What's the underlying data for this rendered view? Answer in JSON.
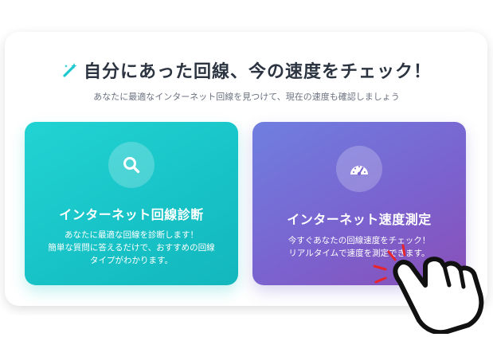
{
  "header": {
    "title": "自分にあった回線、今の速度をチェック！",
    "subtitle": "あなたに最適なインターネット回線を見つけて、現在の速度も確認しましょう",
    "title_icon": "magic-wand-icon"
  },
  "cards": [
    {
      "icon": "search-icon",
      "title": "インターネット回線診断",
      "desc_line1": "あなたに最適な回線を診断します！",
      "desc_line2": "簡単な質問に答えるだけで、おすすめの回線",
      "desc_line3": "タイプがわかります。",
      "color_start": "#22d3d3",
      "color_end": "#12b7bd"
    },
    {
      "icon": "speedometer-icon",
      "title": "インターネット速度測定",
      "desc_line1": "今すぐあなたの回線速度をチェック！",
      "desc_line2": "リアルタイムで速度を測定できます。",
      "color_start": "#6f7fe0",
      "color_end": "#8a4fb8"
    }
  ],
  "overlay": {
    "icon": "pointing-hand-icon",
    "accent_color": "#e8242c"
  }
}
